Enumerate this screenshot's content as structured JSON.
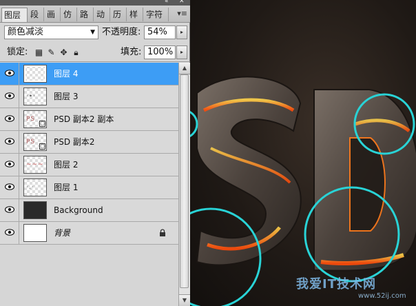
{
  "tabs": [
    {
      "label": "图层"
    },
    {
      "label": "段"
    },
    {
      "label": "画"
    },
    {
      "label": "仿"
    },
    {
      "label": "路"
    },
    {
      "label": "动"
    },
    {
      "label": "历"
    },
    {
      "label": "样"
    },
    {
      "label": "字符"
    }
  ],
  "options": {
    "blend_mode": "颜色减淡",
    "opacity_label": "不透明度:",
    "opacity_value": "54%",
    "lock_label": "锁定:",
    "fill_label": "填充:",
    "fill_value": "100%"
  },
  "layers": [
    {
      "name": "图层 4",
      "selected": true,
      "thumb": "transparent"
    },
    {
      "name": "图层 3",
      "thumb": "transparent"
    },
    {
      "name": "PSD 副本2 副本",
      "thumb": "smart"
    },
    {
      "name": "PSD 副本2",
      "thumb": "smart"
    },
    {
      "name": "图层 2",
      "thumb": "transparent"
    },
    {
      "name": "图层 1",
      "thumb": "transparent"
    },
    {
      "name": "Background",
      "thumb": "dark"
    },
    {
      "name": "背景",
      "thumb": "white",
      "locked": true
    }
  ],
  "watermark": {
    "text": "我爱IT技术网",
    "url": "www.52ij.com"
  },
  "colors": {
    "selection": "#3d9df5",
    "circle": "#29d3d6",
    "lava": "#ff6a12"
  }
}
